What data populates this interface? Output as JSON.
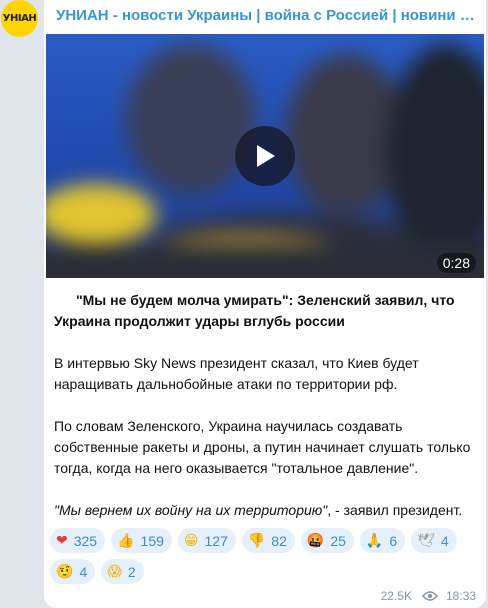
{
  "channel": {
    "avatar_text": "УНІАН",
    "name": "УНИАН - новости Украины | война с Россией | новини Україні…"
  },
  "video": {
    "duration": "0:28",
    "play_icon": "play-icon"
  },
  "post": {
    "headline_open_quote": "\"",
    "headline": "\"Мы не будем молча умирать\": Зеленский заявил, что Украина продолжит удары вглубь россии",
    "para1": "В интервью Sky News президент сказал, что Киев будет наращивать дальнобойные атаки по территории рф.",
    "para2": "По словам Зеленского, Украина научилась создавать собственные ракеты и дроны, а путин начинает слушать только тогда, когда на него оказывается \"тотальное давление\".",
    "quote": "\"Мы вернем их войну на их территорию\"",
    "quote_tail": ", - заявил президент."
  },
  "reactions": [
    {
      "emoji": "❤",
      "icon": "heart-icon",
      "count": "325",
      "color": "#e53935"
    },
    {
      "emoji": "👍",
      "icon": "thumbs-up-icon",
      "count": "159",
      "color": "#f4b400"
    },
    {
      "emoji": "😁",
      "icon": "grin-icon",
      "count": "127",
      "color": "#f4b400"
    },
    {
      "emoji": "👎",
      "icon": "thumbs-down-icon",
      "count": "82",
      "color": "#f4b400"
    },
    {
      "emoji": "🤬",
      "icon": "angry-face-icon",
      "count": "25",
      "color": "#d84315"
    },
    {
      "emoji": "🙏",
      "icon": "pray-icon",
      "count": "6",
      "color": "#f4b400"
    },
    {
      "emoji": "🕊",
      "icon": "dove-icon",
      "count": "4",
      "color": "#9e9e9e"
    },
    {
      "emoji": "🤨",
      "icon": "raised-eyebrow-icon",
      "count": "4",
      "color": "#f4b400"
    },
    {
      "emoji": "😱",
      "icon": "scream-icon",
      "count": "2",
      "color": "#f4b400"
    }
  ],
  "meta": {
    "views": "22.5K",
    "time": "18:33"
  },
  "colors": {
    "accent": "#3a95d6",
    "background": "#dfe5ea",
    "avatar": "#ffd400"
  }
}
